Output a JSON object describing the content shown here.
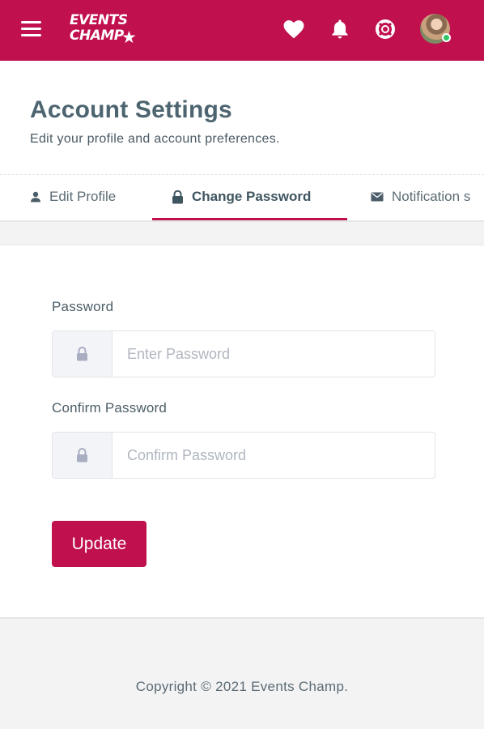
{
  "brand": {
    "logo_line1": "EVENTS",
    "logo_line2": "CHAMP",
    "primary_color": "#c0104e"
  },
  "topbar": {
    "icons": [
      "menu-icon",
      "heart-icon",
      "bell-icon",
      "lifebuoy-icon",
      "user-avatar"
    ]
  },
  "header": {
    "title": "Account Settings",
    "subtitle": "Edit your profile and account preferences."
  },
  "tabs": [
    {
      "label": "Edit Profile",
      "icon": "user-icon",
      "active": false
    },
    {
      "label": "Change Password",
      "icon": "lock-icon",
      "active": true
    },
    {
      "label": "Notification s",
      "icon": "envelope-icon",
      "active": false
    }
  ],
  "form": {
    "password_label": "Password",
    "password_placeholder": "Enter Password",
    "confirm_label": "Confirm Password",
    "confirm_placeholder": "Confirm Password",
    "submit_label": "Update"
  },
  "footer": {
    "copyright": "Copyright © 2021 Events Champ."
  }
}
